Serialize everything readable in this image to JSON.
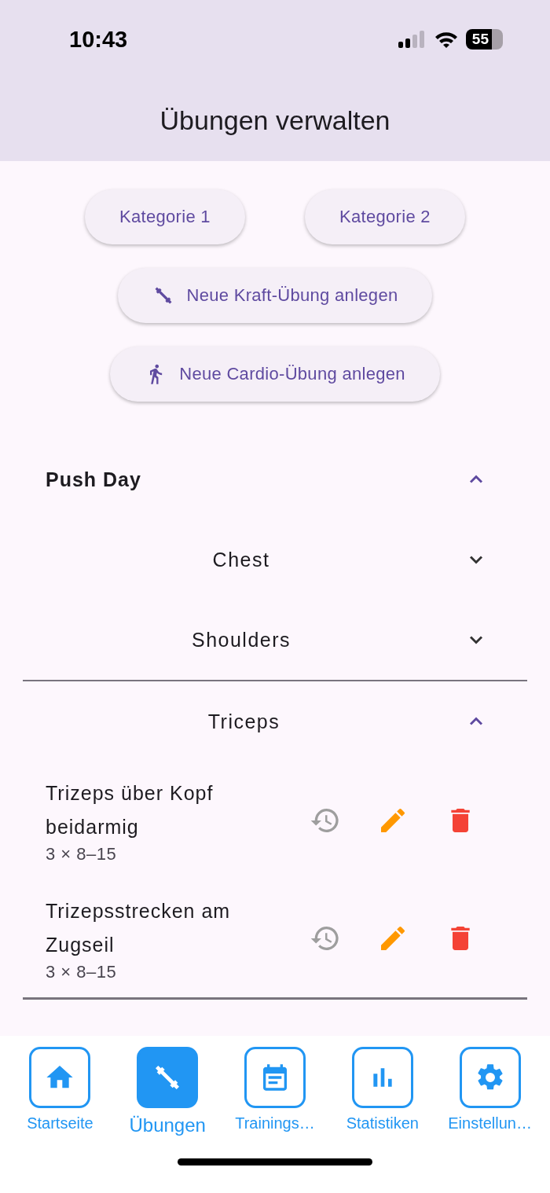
{
  "status_bar": {
    "time": "10:43",
    "battery": "55"
  },
  "app_bar": {
    "title": "Übungen verwalten"
  },
  "category_buttons": [
    "Kategorie 1",
    "Kategorie 2"
  ],
  "action_buttons": [
    {
      "kind": "strength",
      "label": "Neue Kraft-Übung anlegen"
    },
    {
      "kind": "cardio",
      "label": "Neue Cardio-Übung anlegen"
    }
  ],
  "groups": [
    {
      "title": "Push Day",
      "expanded": true,
      "children": [
        {
          "title": "Chest",
          "expanded": false
        },
        {
          "title": "Shoulders",
          "expanded": false
        },
        {
          "title": "Triceps",
          "expanded": true,
          "exercises": [
            {
              "name": "Trizeps über Kopf beidarmig",
              "sets": "3 × 8–15"
            },
            {
              "name": "Trizepsstrecken am Zugseil",
              "sets": "3 × 8–15"
            }
          ]
        }
      ]
    }
  ],
  "nav": [
    {
      "label": "Startseite",
      "selected": false
    },
    {
      "label": "Übungen",
      "selected": true
    },
    {
      "label": "Trainings…",
      "selected": false
    },
    {
      "label": "Statistiken",
      "selected": false
    },
    {
      "label": "Einstellun…",
      "selected": false
    }
  ]
}
